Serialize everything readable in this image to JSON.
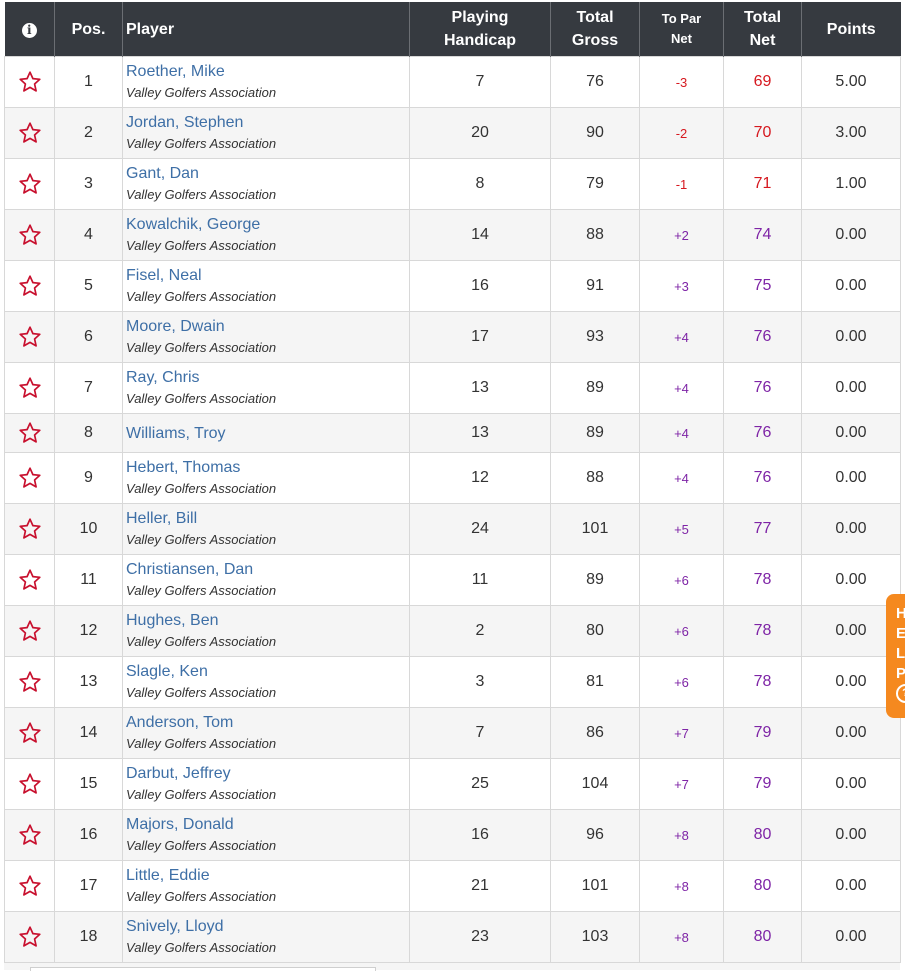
{
  "header": {
    "info_icon": "i",
    "pos": "Pos.",
    "player": "Player",
    "playing_handicap_1": "Playing",
    "playing_handicap_2": "Handicap",
    "total_gross_1": "Total",
    "total_gross_2": "Gross",
    "to_par_net_1": "To Par",
    "to_par_net_2": "Net",
    "total_net_1": "Total",
    "total_net_2": "Net",
    "points": "Points"
  },
  "colors": {
    "header_bg": "#363a40",
    "link": "#3e6fa6",
    "under_par": "#d6181f",
    "over_par": "#7e24a6",
    "star": "#c8102e",
    "help_tab": "#f5891f"
  },
  "rows": [
    {
      "pos": "1",
      "name": "Roether, Mike",
      "club": "Valley Golfers Association",
      "hcp": "7",
      "gross": "76",
      "topar": "-3",
      "net": "69",
      "points": "5.00"
    },
    {
      "pos": "2",
      "name": "Jordan, Stephen",
      "club": "Valley Golfers Association",
      "hcp": "20",
      "gross": "90",
      "topar": "-2",
      "net": "70",
      "points": "3.00"
    },
    {
      "pos": "3",
      "name": "Gant, Dan",
      "club": "Valley Golfers Association",
      "hcp": "8",
      "gross": "79",
      "topar": "-1",
      "net": "71",
      "points": "1.00"
    },
    {
      "pos": "4",
      "name": "Kowalchik, George",
      "club": "Valley Golfers Association",
      "hcp": "14",
      "gross": "88",
      "topar": "+2",
      "net": "74",
      "points": "0.00"
    },
    {
      "pos": "5",
      "name": "Fisel, Neal",
      "club": "Valley Golfers Association",
      "hcp": "16",
      "gross": "91",
      "topar": "+3",
      "net": "75",
      "points": "0.00"
    },
    {
      "pos": "6",
      "name": "Moore, Dwain",
      "club": "Valley Golfers Association",
      "hcp": "17",
      "gross": "93",
      "topar": "+4",
      "net": "76",
      "points": "0.00"
    },
    {
      "pos": "7",
      "name": "Ray, Chris",
      "club": "Valley Golfers Association",
      "hcp": "13",
      "gross": "89",
      "topar": "+4",
      "net": "76",
      "points": "0.00"
    },
    {
      "pos": "8",
      "name": "Williams, Troy",
      "club": "",
      "hcp": "13",
      "gross": "89",
      "topar": "+4",
      "net": "76",
      "points": "0.00"
    },
    {
      "pos": "9",
      "name": "Hebert, Thomas",
      "club": "Valley Golfers Association",
      "hcp": "12",
      "gross": "88",
      "topar": "+4",
      "net": "76",
      "points": "0.00"
    },
    {
      "pos": "10",
      "name": "Heller, Bill",
      "club": "Valley Golfers Association",
      "hcp": "24",
      "gross": "101",
      "topar": "+5",
      "net": "77",
      "points": "0.00"
    },
    {
      "pos": "11",
      "name": "Christiansen, Dan",
      "club": "Valley Golfers Association",
      "hcp": "11",
      "gross": "89",
      "topar": "+6",
      "net": "78",
      "points": "0.00"
    },
    {
      "pos": "12",
      "name": "Hughes, Ben",
      "club": "Valley Golfers Association",
      "hcp": "2",
      "gross": "80",
      "topar": "+6",
      "net": "78",
      "points": "0.00"
    },
    {
      "pos": "13",
      "name": "Slagle, Ken",
      "club": "Valley Golfers Association",
      "hcp": "3",
      "gross": "81",
      "topar": "+6",
      "net": "78",
      "points": "0.00"
    },
    {
      "pos": "14",
      "name": "Anderson, Tom",
      "club": "Valley Golfers Association",
      "hcp": "7",
      "gross": "86",
      "topar": "+7",
      "net": "79",
      "points": "0.00"
    },
    {
      "pos": "15",
      "name": "Darbut, Jeffrey",
      "club": "Valley Golfers Association",
      "hcp": "25",
      "gross": "104",
      "topar": "+7",
      "net": "79",
      "points": "0.00"
    },
    {
      "pos": "16",
      "name": "Majors, Donald",
      "club": "Valley Golfers Association",
      "hcp": "16",
      "gross": "96",
      "topar": "+8",
      "net": "80",
      "points": "0.00"
    },
    {
      "pos": "17",
      "name": "Little, Eddie",
      "club": "Valley Golfers Association",
      "hcp": "21",
      "gross": "101",
      "topar": "+8",
      "net": "80",
      "points": "0.00"
    },
    {
      "pos": "18",
      "name": "Snively, Lloyd",
      "club": "Valley Golfers Association",
      "hcp": "23",
      "gross": "103",
      "topar": "+8",
      "net": "80",
      "points": "0.00"
    }
  ],
  "help_tab": {
    "letters": [
      "H",
      "E",
      "L",
      "P"
    ],
    "icon": "?"
  }
}
